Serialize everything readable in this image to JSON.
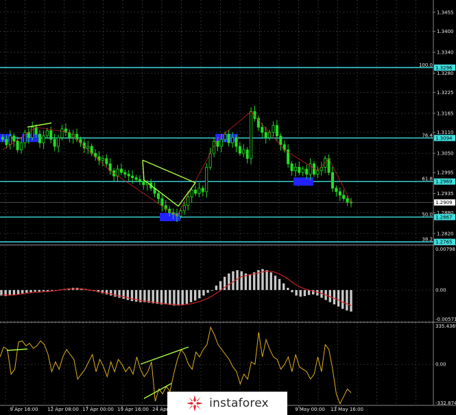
{
  "colors": {
    "background": "#000000",
    "grid": "#3a3a3a",
    "axis_text": "#e8e8e8",
    "level_line": "#40e0e0",
    "candle": "#22dd22",
    "highlight_box": "#2222ff",
    "divergence": "#aaff44",
    "macd_hist": "#c8c8c8",
    "macd_signal": "#cc2222",
    "cci": "#e0b020"
  },
  "chart_data": [
    {
      "type": "candlestick",
      "x_ticks": [
        "9 Apr 16:00",
        "12 Apr 08:00",
        "17 Apr 00:00",
        "19 Apr 16:00",
        "24 Apr 08:00",
        "9 May 00:00",
        "13 May 16:00"
      ],
      "y_ticks": [
        "1.3455",
        "1.3400",
        "1.3340",
        "1.3280",
        "1.3225",
        "1.3165",
        "1.3110",
        "1.3050",
        "1.2995",
        "1.2935",
        "1.2880",
        "1.2820"
      ],
      "ylim": [
        1.279,
        1.349
      ],
      "levels": [
        {
          "label": "100.0",
          "value": 1.3296,
          "badge": "1.3296"
        },
        {
          "label": "76.4",
          "value": 1.3094,
          "badge": "1.3094"
        },
        {
          "label": "61.8",
          "value": 1.2969,
          "badge": "1.2969"
        },
        {
          "label": "50.0",
          "value": 1.2867,
          "badge": "1.2867"
        },
        {
          "label": "38.2",
          "value": 1.2765,
          "badge": "1.2765"
        }
      ],
      "current_price": "1.2909",
      "closes": [
        1.309,
        1.3075,
        1.31,
        1.3085,
        1.306,
        1.308,
        1.311,
        1.3095,
        1.3125,
        1.3105,
        1.308,
        1.31,
        1.3115,
        1.309,
        1.307,
        1.3095,
        1.312,
        1.311,
        1.3095,
        1.3105,
        1.309,
        1.308,
        1.3065,
        1.307,
        1.305,
        1.304,
        1.303,
        1.3035,
        1.302,
        1.3,
        1.2985,
        1.3005,
        1.2995,
        1.299,
        1.2985,
        1.298,
        1.2975,
        1.297,
        1.296,
        1.2965,
        1.295,
        1.2935,
        1.292,
        1.29,
        1.289,
        1.288,
        1.2875,
        1.287,
        1.2885,
        1.29,
        1.2925,
        1.2945,
        1.2935,
        1.295,
        1.294,
        1.301,
        1.305,
        1.3085,
        1.307,
        1.309,
        1.3105,
        1.308,
        1.3095,
        1.307,
        1.305,
        1.306,
        1.3035,
        1.317,
        1.315,
        1.3125,
        1.311,
        1.3095,
        1.311,
        1.313,
        1.31,
        1.3075,
        1.306,
        1.302,
        1.3,
        1.301,
        1.2995,
        1.3005,
        1.299,
        1.302,
        1.299,
        1.3,
        1.301,
        1.3035,
        1.2995,
        1.295,
        1.294,
        1.293,
        1.292,
        1.291,
        1.2909
      ]
    },
    {
      "type": "bar",
      "name": "MACD",
      "y_ticks": [
        "0.00798",
        "0.00",
        "-0.00571"
      ],
      "ylim": [
        -0.00571,
        0.00798
      ],
      "values": [
        -0.001,
        -0.0011,
        -0.001,
        -0.0009,
        -0.0008,
        -0.0006,
        -0.0005,
        -0.0004,
        -0.0003,
        -0.0003,
        -0.0002,
        -0.0002,
        -0.0001,
        0.0,
        0.0001,
        0.0002,
        0.0003,
        0.0004,
        0.0004,
        0.0003,
        0.0002,
        0.0,
        -0.0002,
        -0.0004,
        -0.0006,
        -0.0008,
        -0.001,
        -0.0012,
        -0.0014,
        -0.0016,
        -0.0018,
        -0.002,
        -0.0021,
        -0.0022,
        -0.0022,
        -0.0023,
        -0.0024,
        -0.0025,
        -0.0026,
        -0.0026,
        -0.0027,
        -0.0028,
        -0.0028,
        -0.0027,
        -0.0025,
        -0.0022,
        -0.0019,
        -0.0015,
        -0.001,
        -0.0005,
        0.0,
        0.0008,
        0.0016,
        0.0024,
        0.003,
        0.0034,
        0.0036,
        0.0034,
        0.003,
        0.0028,
        0.0032,
        0.0036,
        0.0038,
        0.0036,
        0.0032,
        0.0026,
        0.002,
        0.0012,
        0.0004,
        -0.0004,
        -0.001,
        -0.0012,
        -0.0011,
        -0.0009,
        -0.0008,
        -0.001,
        -0.0014,
        -0.0018,
        -0.0022,
        -0.0026,
        -0.003,
        -0.0034,
        -0.0037,
        -0.0039
      ],
      "signal": [
        -0.0008,
        -0.0009,
        -0.0009,
        -0.0009,
        -0.0008,
        -0.0007,
        -0.0006,
        -0.0005,
        -0.0004,
        -0.0004,
        -0.0003,
        -0.0003,
        -0.0002,
        -0.0001,
        0.0,
        0.0001,
        0.0002,
        0.0002,
        0.0002,
        0.0002,
        0.0001,
        0.0,
        -0.0001,
        -0.0003,
        -0.0004,
        -0.0006,
        -0.0007,
        -0.0009,
        -0.0011,
        -0.0012,
        -0.0014,
        -0.0016,
        -0.0017,
        -0.0019,
        -0.002,
        -0.0021,
        -0.0022,
        -0.0023,
        -0.0024,
        -0.0025,
        -0.0026,
        -0.0026,
        -0.0027,
        -0.0027,
        -0.0026,
        -0.0025,
        -0.0023,
        -0.0021,
        -0.0018,
        -0.0015,
        -0.0011,
        -0.0006,
        -0.0001,
        0.0005,
        0.001,
        0.0015,
        0.002,
        0.0024,
        0.0026,
        0.0028,
        0.0029,
        0.0031,
        0.0033,
        0.0034,
        0.0034,
        0.0032,
        0.0029,
        0.0025,
        0.002,
        0.0014,
        0.0009,
        0.0005,
        0.0002,
        0.0,
        -0.0002,
        -0.0004,
        -0.0006,
        -0.0009,
        -0.0012,
        -0.0015,
        -0.0018,
        -0.0022,
        -0.0025,
        -0.0028
      ]
    },
    {
      "type": "line",
      "name": "CCI",
      "y_ticks": [
        "335.4369",
        "0.00",
        "-332.874"
      ],
      "ylim": [
        -332.874,
        335.4369
      ],
      "values": [
        60,
        140,
        120,
        -80,
        -40,
        180,
        190,
        150,
        170,
        130,
        150,
        190,
        160,
        80,
        -60,
        20,
        -40,
        60,
        120,
        80,
        40,
        -120,
        -80,
        -40,
        20,
        80,
        -60,
        40,
        -20,
        -100,
        20,
        -60,
        40,
        0,
        -60,
        -20,
        -80,
        60,
        -40,
        -100,
        -60,
        20,
        -300,
        -200,
        -240,
        -180,
        -220,
        -80,
        40,
        120,
        80,
        0,
        -40,
        100,
        60,
        120,
        160,
        300,
        240,
        160,
        120,
        80,
        40,
        -20,
        -60,
        -160,
        -80,
        -120,
        20,
        0,
        260,
        60,
        200,
        120,
        60,
        40,
        -40,
        0,
        60,
        -60,
        80,
        -20,
        -40,
        -60,
        -120,
        -80,
        60,
        -60,
        160,
        120,
        -40,
        -240,
        -320,
        -260,
        -200,
        -230
      ]
    }
  ]
}
